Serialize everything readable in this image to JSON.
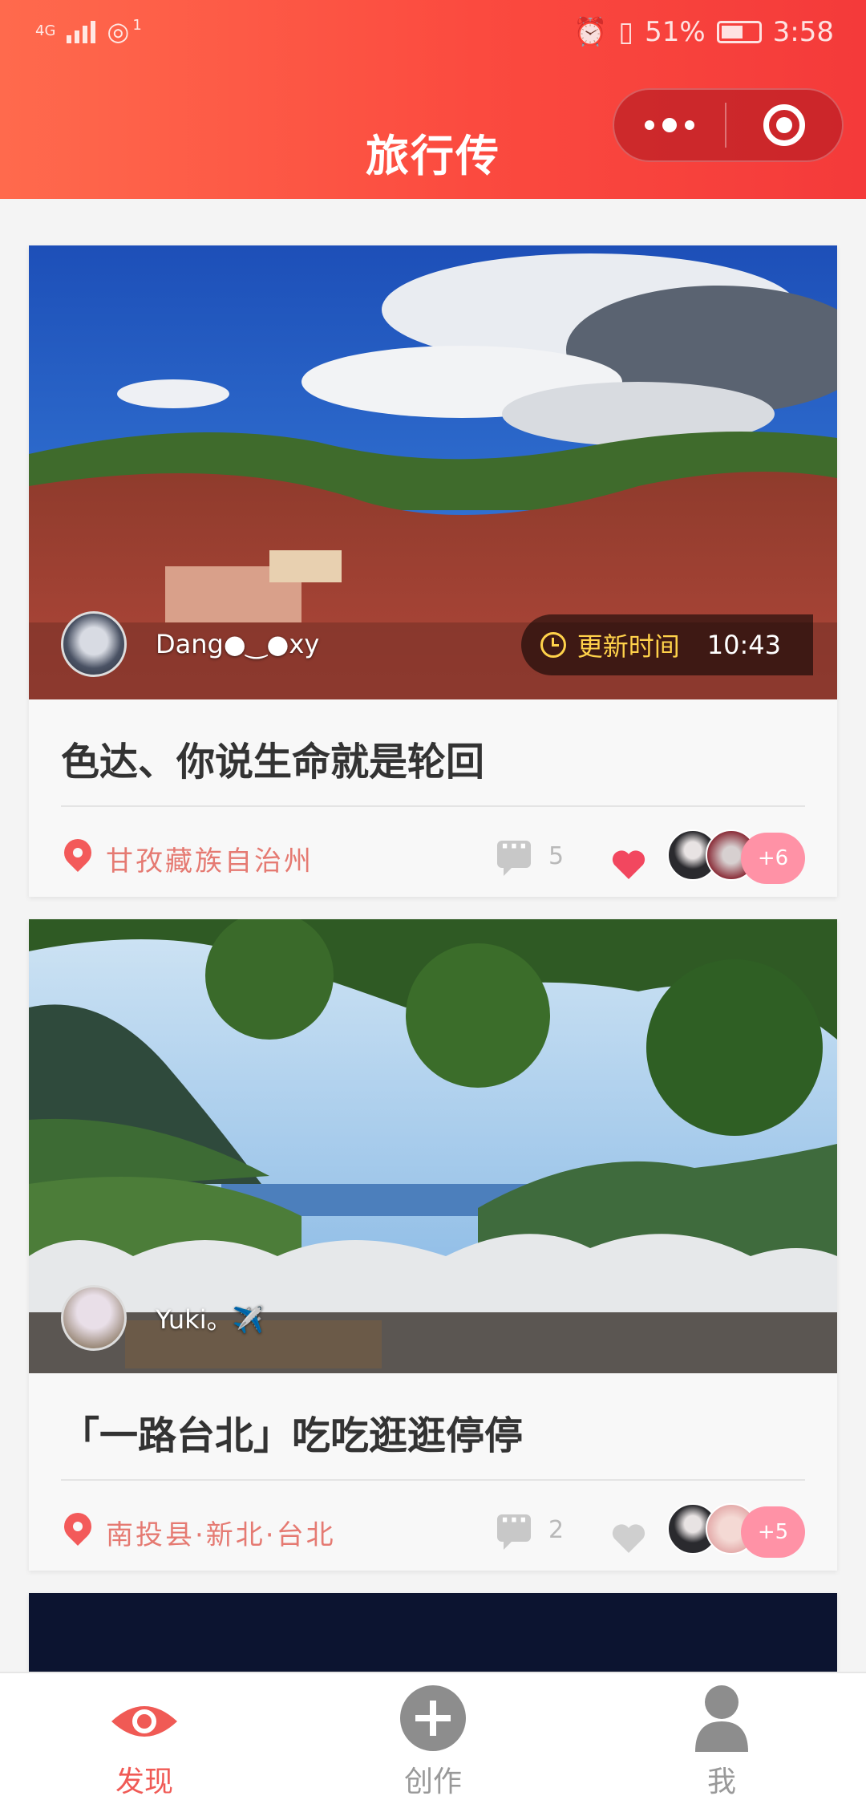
{
  "status_bar": {
    "network": "4G",
    "notification": "1",
    "battery": "51%",
    "time": "3:58"
  },
  "header": {
    "title": "旅行传"
  },
  "cards": [
    {
      "author": "Dang●‿●xy",
      "update_label": "更新时间",
      "update_time": "10:43",
      "title": "色达、你说生命就是轮回",
      "location": "甘孜藏族自治州",
      "comment_count": "5",
      "liked": true,
      "likers_more": "+6",
      "colors": {
        "heart": "#f2475f"
      }
    },
    {
      "author": "Yuki。✈️",
      "title": "「一路台北」吃吃逛逛停停",
      "location": "南投县·新北·台北",
      "comment_count": "2",
      "liked": false,
      "likers_more": "+5",
      "colors": {
        "heart": "#cfcfcf"
      }
    }
  ],
  "tabbar": {
    "items": [
      {
        "label": "发现",
        "icon": "eye-icon",
        "active": true
      },
      {
        "label": "创作",
        "icon": "plus-circle-icon",
        "active": false
      },
      {
        "label": "我",
        "icon": "person-icon",
        "active": false
      }
    ]
  },
  "colors": {
    "accent": "#f44a3e",
    "active_tab": "#f05a55",
    "location_text": "#e57a72",
    "badge": "#ff92a6"
  }
}
